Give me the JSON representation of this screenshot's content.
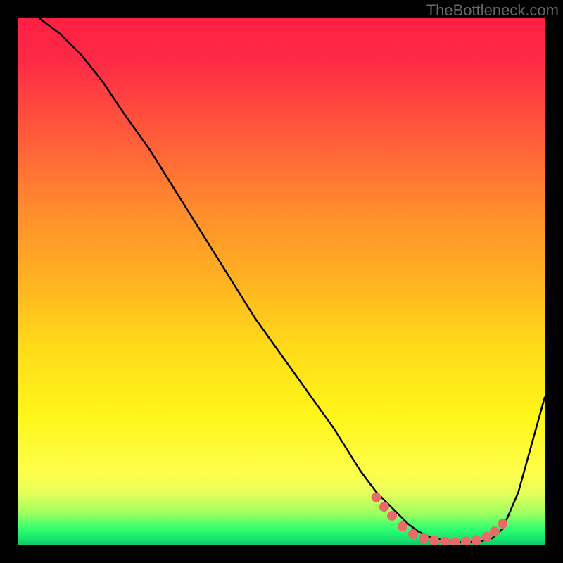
{
  "watermark": "TheBottleneck.com",
  "chart_data": {
    "type": "line",
    "title": "",
    "xlabel": "",
    "ylabel": "",
    "xlim": [
      0,
      100
    ],
    "ylim": [
      0,
      100
    ],
    "series": [
      {
        "name": "bottleneck-curve",
        "x": [
          4,
          8,
          12,
          16,
          20,
          25,
          30,
          35,
          40,
          45,
          50,
          55,
          60,
          65,
          68,
          70,
          72,
          74,
          76,
          78,
          80,
          82,
          84,
          86,
          88,
          90,
          92,
          95,
          100
        ],
        "y": [
          100,
          97,
          93,
          88,
          82,
          75,
          67,
          59,
          51,
          43,
          36,
          29,
          22,
          14,
          10,
          8,
          6,
          4,
          2.5,
          1.5,
          1,
          0.7,
          0.5,
          0.5,
          0.7,
          1.2,
          3,
          10,
          28
        ]
      }
    ],
    "markers": {
      "name": "highlight-dots",
      "points": [
        {
          "x": 68,
          "y": 9
        },
        {
          "x": 69.5,
          "y": 7.2
        },
        {
          "x": 71,
          "y": 5.5
        },
        {
          "x": 73,
          "y": 3.5
        },
        {
          "x": 75,
          "y": 2
        },
        {
          "x": 77,
          "y": 1.2
        },
        {
          "x": 79,
          "y": 0.8
        },
        {
          "x": 81,
          "y": 0.6
        },
        {
          "x": 83,
          "y": 0.5
        },
        {
          "x": 85,
          "y": 0.6
        },
        {
          "x": 87,
          "y": 0.9
        },
        {
          "x": 89,
          "y": 1.5
        },
        {
          "x": 90.5,
          "y": 2.5
        },
        {
          "x": 92,
          "y": 4
        }
      ]
    },
    "gradient_stops": [
      {
        "pos": 0,
        "color": "#ff1f44"
      },
      {
        "pos": 50,
        "color": "#ffb321"
      },
      {
        "pos": 80,
        "color": "#fffe4a"
      },
      {
        "pos": 100,
        "color": "#10c766"
      }
    ]
  }
}
